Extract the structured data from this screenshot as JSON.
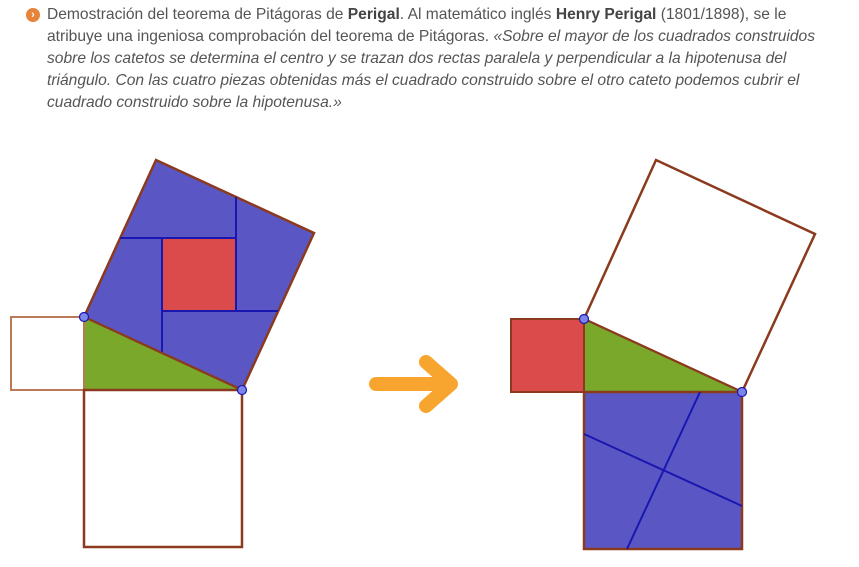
{
  "caption": {
    "bullet_glyph": "›",
    "intro": "Demostración del teorema de Pitágoras de ",
    "name1": "Perigal",
    "mid": ". Al matemático inglés ",
    "name2": "Henry Perigal",
    "years": " (1801/1898), se le atribuye una ingeniosa comprobación del teorema de Pitágoras. ",
    "quote": "«Sobre el mayor de los cuadrados construidos sobre los catetos se determina el centro y se trazan dos rectas paralela y perpendicular a la hipotenusa del triángulo. Con las cuatro piezas obtenidas más el cuadrado construido sobre el otro cateto podemos cubrir el cuadrado construido sobre la hipotenusa.»"
  },
  "colors": {
    "blue_fill": "#5a57c4",
    "blue_line": "#1a17b0",
    "red_fill": "#dc4b4b",
    "green_fill": "#7aa82a",
    "outline": "#8b3a1e",
    "small_square_outline": "#b97a55",
    "vertex": "#7c86e8",
    "arrow": "#f7a52e",
    "text": "#555555",
    "bullet": "#e6843a"
  },
  "icons": {
    "bullet": "chevron-right-circle-icon",
    "arrow": "right-arrow-icon"
  }
}
